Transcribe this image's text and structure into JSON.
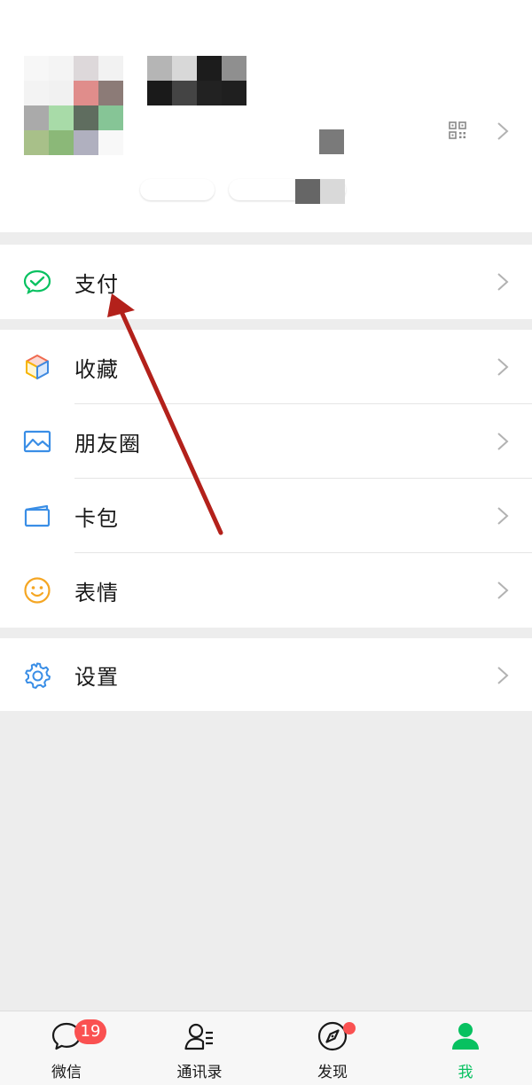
{
  "menu": {
    "pay": "支付",
    "favorites": "收藏",
    "moments": "朋友圈",
    "cards": "卡包",
    "stickers": "表情",
    "settings": "设置"
  },
  "tabbar": {
    "chats": "微信",
    "chats_badge": "19",
    "contacts": "通讯录",
    "discover": "发现",
    "me": "我"
  },
  "colors": {
    "accent_green": "#07c160",
    "badge_red": "#fa5151",
    "annotation_arrow": "#b3211b"
  },
  "icons": [
    "qr-code-icon",
    "chevron-right-icon",
    "wechat-pay-icon",
    "favorites-cube-icon",
    "moments-image-icon",
    "card-wallet-icon",
    "smiley-icon",
    "gear-icon",
    "chat-bubble-icon",
    "contacts-icon",
    "compass-icon",
    "person-icon"
  ]
}
